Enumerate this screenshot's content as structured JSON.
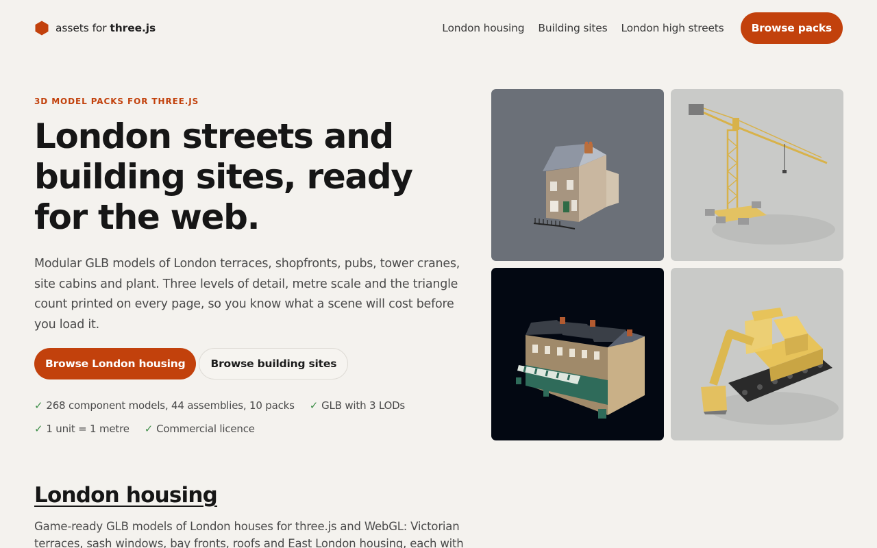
{
  "header": {
    "brand_prefix": "assets for ",
    "brand_bold": "three.js",
    "brand_color": "#c2410c",
    "nav": [
      "London housing",
      "Building sites",
      "London high streets"
    ],
    "cta": "Browse packs"
  },
  "hero": {
    "eyebrow": "3D MODEL PACKS FOR THREE.JS",
    "headline": "London streets and building sites, ready for the web.",
    "lede": "Modular GLB models of London terraces, shopfronts, pubs, tower cranes, site cabins and plant. Three levels of detail, metre scale and the triangle count printed on every page, so you know what a scene will cost before you load it.",
    "cta_primary": "Browse London housing",
    "cta_secondary": "Browse building sites",
    "features": [
      "268 component models, 44 assemblies, 10 packs",
      "GLB with 3 LODs",
      "1 unit = 1 metre",
      "Commercial licence"
    ],
    "tick": "✓"
  },
  "gallery": [
    {
      "subject": "terraced-house",
      "bg": "#6b7078"
    },
    {
      "subject": "tower-crane",
      "bg": "#c9cac8"
    },
    {
      "subject": "shopfront-terrace",
      "bg": "#030812"
    },
    {
      "subject": "excavator",
      "bg": "#c9cac8"
    }
  ],
  "section": {
    "title": "London housing",
    "text": "Game-ready GLB models of London houses for three.js and WebGL: Victorian terraces, sash windows, bay fronts, roofs and East London housing, each with low,"
  },
  "colors": {
    "accent": "#c2410c",
    "background": "#f4f2ee",
    "tick": "#3f8f4a"
  }
}
